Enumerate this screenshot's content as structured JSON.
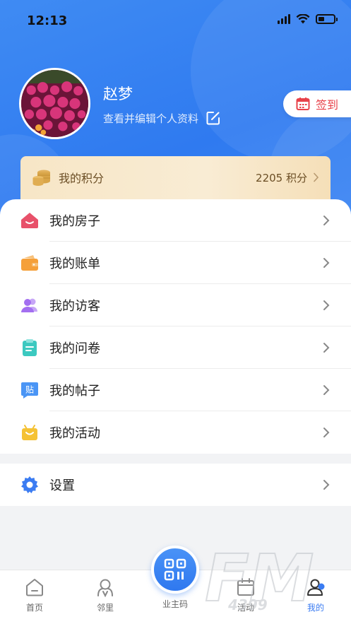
{
  "status_bar": {
    "time": "12:13"
  },
  "profile": {
    "name": "赵梦",
    "subtitle": "查看并编辑个人资料"
  },
  "checkin": {
    "label": "签到"
  },
  "points": {
    "label": "我的积分",
    "value": "2205 积分"
  },
  "menu": {
    "items": [
      {
        "label": "我的房子",
        "icon": "house-icon",
        "color": "#e8516a"
      },
      {
        "label": "我的账单",
        "icon": "wallet-icon",
        "color": "#f5a03a"
      },
      {
        "label": "我的访客",
        "icon": "visitors-icon",
        "color": "#a36ff0"
      },
      {
        "label": "我的问卷",
        "icon": "clipboard-icon",
        "color": "#3cc9c0"
      },
      {
        "label": "我的帖子",
        "icon": "post-icon",
        "color": "#4a95f5"
      },
      {
        "label": "我的活动",
        "icon": "activity-icon",
        "color": "#f5c234"
      }
    ]
  },
  "settings": {
    "label": "设置",
    "icon": "gear-icon",
    "color": "#3b7cf2"
  },
  "post_icon_glyph": "贴",
  "tabbar": {
    "tabs": [
      {
        "label": "首页",
        "icon": "home-icon"
      },
      {
        "label": "邻里",
        "icon": "neighbors-icon"
      },
      {
        "label": "业主码",
        "icon": "qr-code-icon"
      },
      {
        "label": "活动",
        "icon": "activity-tab-icon"
      },
      {
        "label": "我的",
        "icon": "profile-icon"
      }
    ],
    "active_index": 4
  },
  "watermark": {
    "text": "FM",
    "subtext": "4399"
  },
  "colors": {
    "header_blue": "#2f7af0",
    "accent_blue": "#3b7cf2",
    "checkin_red": "#e8424a",
    "points_brown": "#6b4e25"
  }
}
